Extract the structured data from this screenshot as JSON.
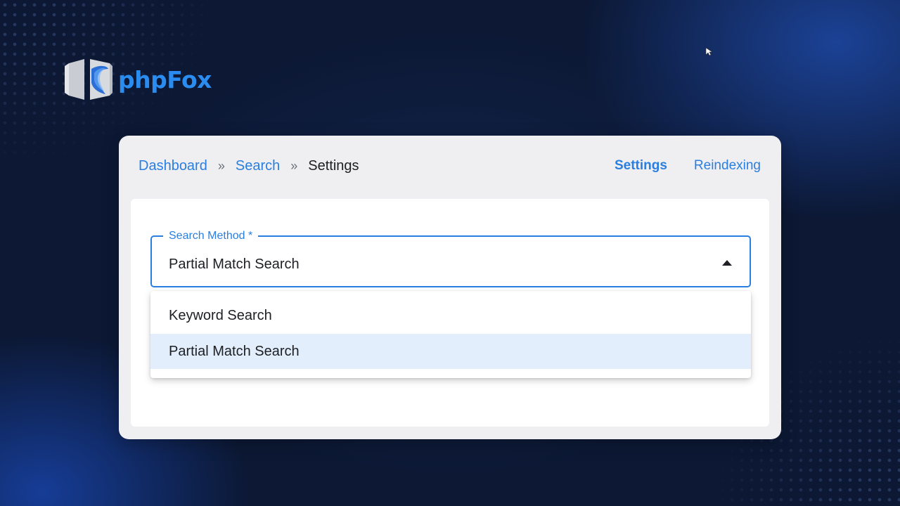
{
  "brand": {
    "name": "phpFox",
    "color": "#2b8cf0",
    "icon": "phpfox-logo-icon"
  },
  "breadcrumb": {
    "items": [
      "Dashboard",
      "Search",
      "Settings"
    ],
    "separator": "»"
  },
  "tabs": [
    {
      "label": "Settings",
      "active": true
    },
    {
      "label": "Reindexing",
      "active": false
    }
  ],
  "form": {
    "search_method": {
      "label": "Search Method *",
      "value": "Partial Match Search",
      "expanded": true,
      "caret_icon": "caret-up-icon",
      "options": [
        "Keyword Search",
        "Partial Match Search"
      ],
      "selected_index": 1
    }
  },
  "colors": {
    "accent": "#2a7ee0",
    "selected_option_bg": "#e3eefc",
    "background": "#0b1631"
  }
}
